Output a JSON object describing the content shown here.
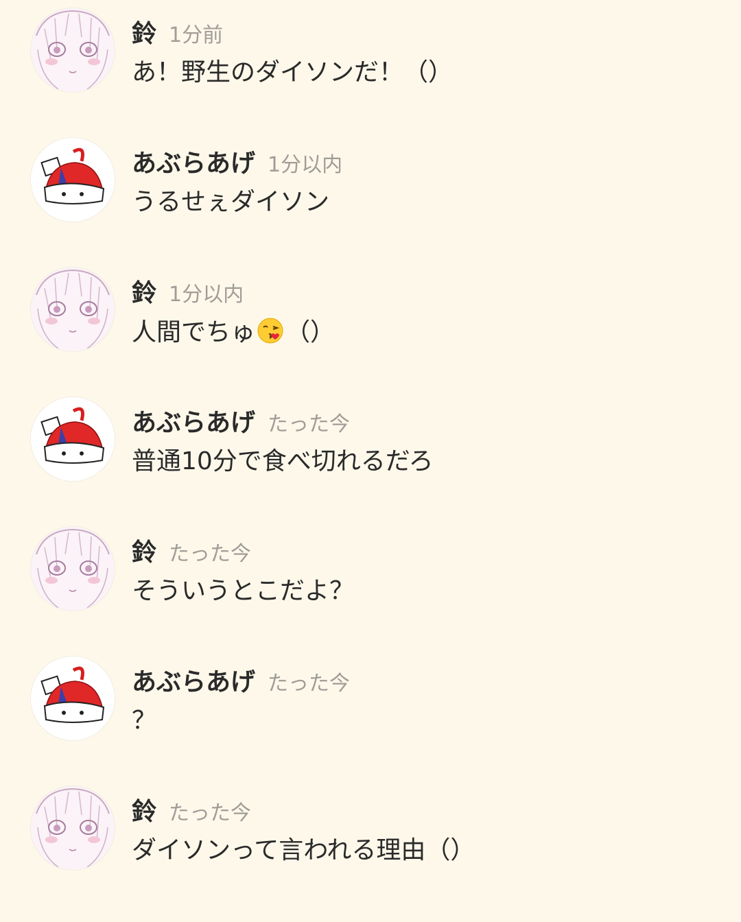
{
  "messages": [
    {
      "user": "鈴",
      "avatar": "girl-avatar",
      "time": "1分前",
      "text": "あ！野生のダイソンだ！（）"
    },
    {
      "user": "あぶらあげ",
      "avatar": "red-hair-avatar",
      "time": "1分以内",
      "text": "うるせぇダイソン"
    },
    {
      "user": "鈴",
      "avatar": "girl-avatar",
      "time": "1分以内",
      "text_before": "人間でちゅ",
      "emoji": "kissing-face-emoji",
      "text_after": "（）"
    },
    {
      "user": "あぶらあげ",
      "avatar": "red-hair-avatar",
      "time": "たった今",
      "text": "普通10分で食べ切れるだろ"
    },
    {
      "user": "鈴",
      "avatar": "girl-avatar",
      "time": "たった今",
      "text": "そういうとこだよ？"
    },
    {
      "user": "あぶらあげ",
      "avatar": "red-hair-avatar",
      "time": "たった今",
      "text": "？"
    },
    {
      "user": "鈴",
      "avatar": "girl-avatar",
      "time": "たった今",
      "text": "ダイソンって言われる理由（）"
    }
  ]
}
